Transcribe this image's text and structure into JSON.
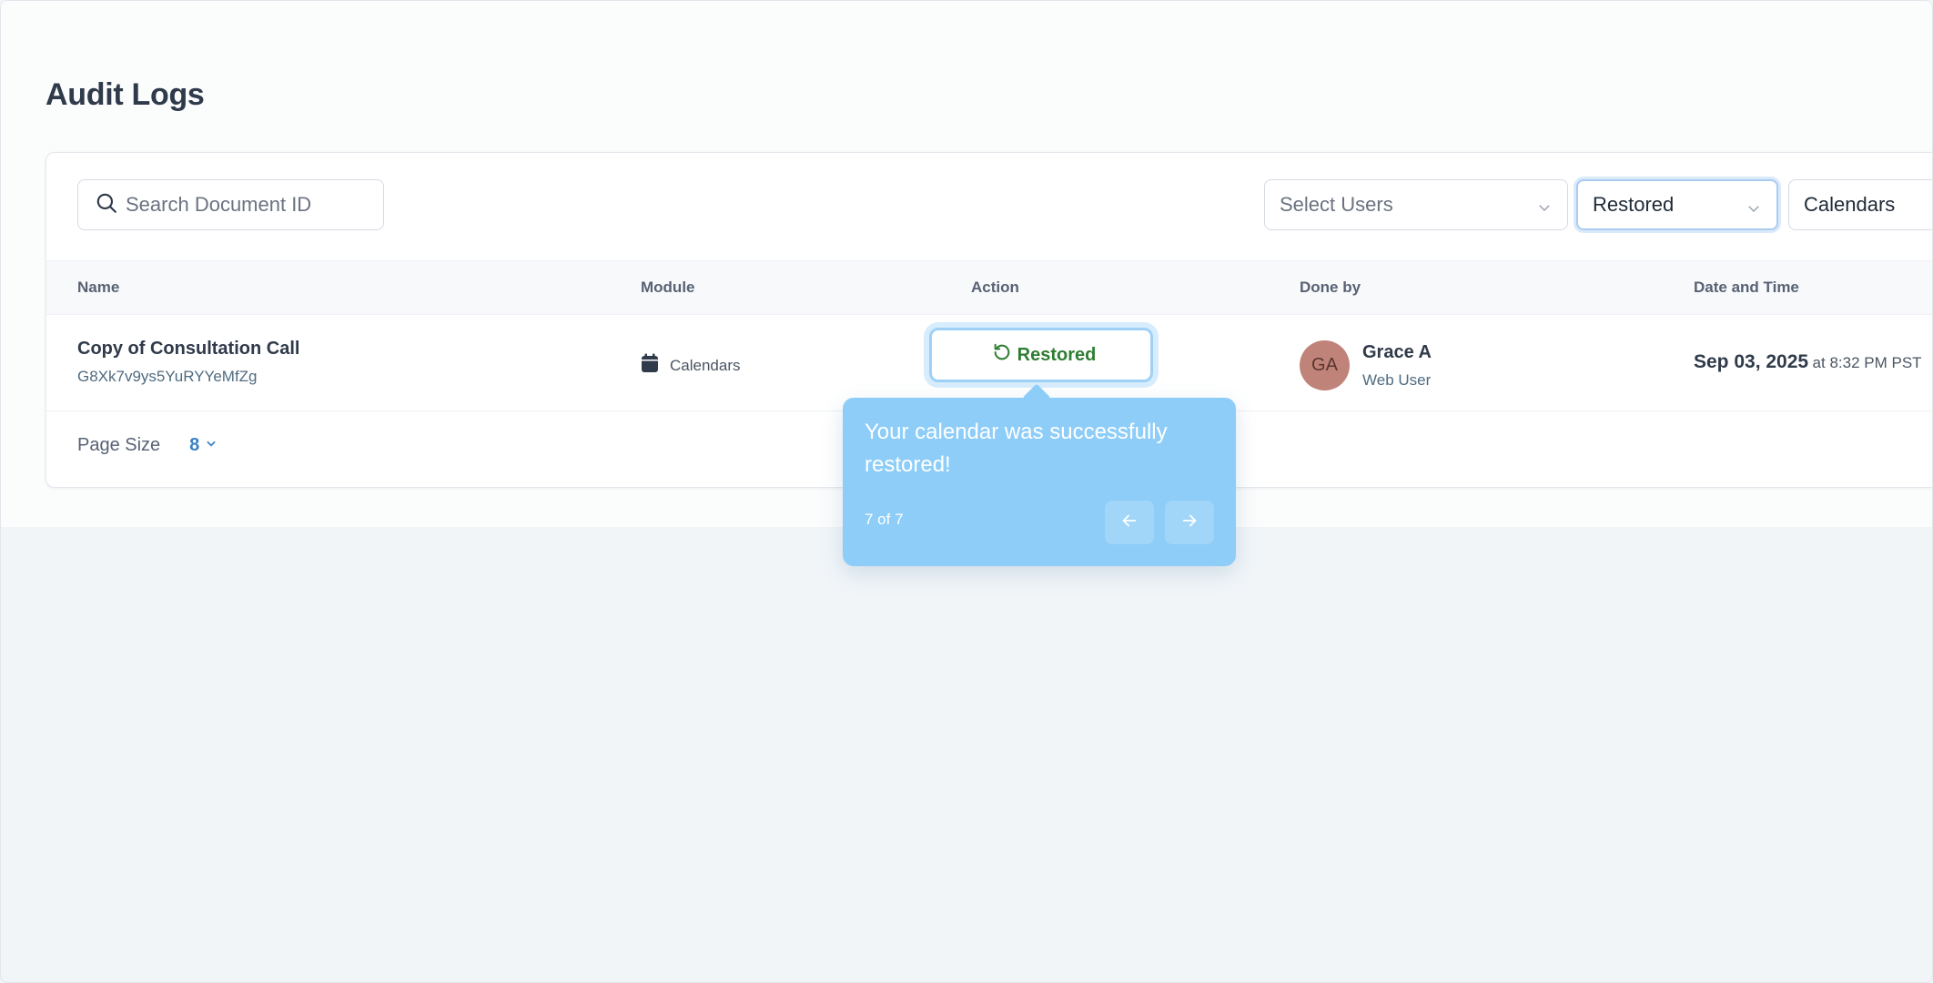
{
  "page": {
    "title": "Audit Logs"
  },
  "filters": {
    "search_placeholder": "Search Document ID",
    "users_placeholder": "Select Users",
    "action_value": "Restored",
    "module_value": "Calendars"
  },
  "table": {
    "columns": [
      "Name",
      "Module",
      "Action",
      "Done by",
      "Date and Time"
    ],
    "rows": [
      {
        "name": "Copy of Consultation Call",
        "doc_id": "G8Xk7v9ys5YuRYYeMfZg",
        "module": "Calendars",
        "module_icon": "calendar-icon",
        "action": "Restored",
        "action_icon": "restore-icon",
        "user_initials": "GA",
        "user_name": "Grace A",
        "user_role": "Web User",
        "date": "Sep 03, 2025",
        "time": "at 8:32 PM PST"
      }
    ]
  },
  "footer": {
    "page_size_label": "Page Size",
    "page_size_value": "8"
  },
  "tooltip": {
    "message": "Your calendar was successfully restored!",
    "step": "7 of 7"
  },
  "colors": {
    "accent": "#3b82c4",
    "restored_green": "#2e7d32",
    "tooltip_bg": "#8dcdf8",
    "avatar_bg": "#c0837a"
  }
}
